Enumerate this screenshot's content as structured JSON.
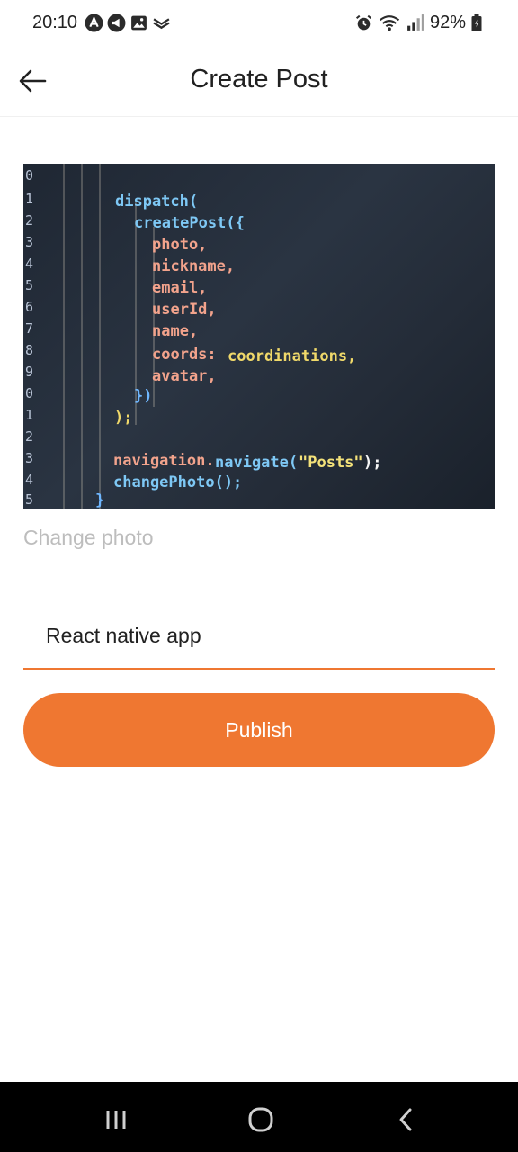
{
  "status_bar": {
    "time": "20:10",
    "battery": "92%",
    "left_icons": [
      "app-a-icon",
      "megaphone-icon",
      "image-icon",
      "double-chevron-icon"
    ],
    "right_icons": [
      "alarm-icon",
      "wifi-icon",
      "signal-icon",
      "battery-icon"
    ]
  },
  "header": {
    "title": "Create Post",
    "back_icon": "arrow-left-icon"
  },
  "photo": {
    "line_numbers": [
      "0",
      "1",
      "2",
      "3",
      "4",
      "5",
      "6",
      "7",
      "8",
      "9",
      "0",
      "1",
      "2",
      "3",
      "4",
      "5"
    ],
    "code": [
      "dispatch(",
      "createPost({",
      "photo,",
      "nickname,",
      "email,",
      "userId,",
      "name,",
      "coords:",
      "coordinations,",
      "avatar,",
      "})",
      ");",
      "navigation.",
      "navigate(",
      "\"Posts\"",
      ");",
      "changePhoto();",
      "}"
    ]
  },
  "change_photo_label": "Change photo",
  "title_input": {
    "value": "React native app"
  },
  "publish_label": "Publish",
  "colors": {
    "accent": "#ef7731",
    "muted_text": "#bdbdbd",
    "nav_bar": "#000000"
  },
  "nav_bar": {
    "icons": [
      "recent-apps-icon",
      "home-icon",
      "back-icon"
    ]
  }
}
